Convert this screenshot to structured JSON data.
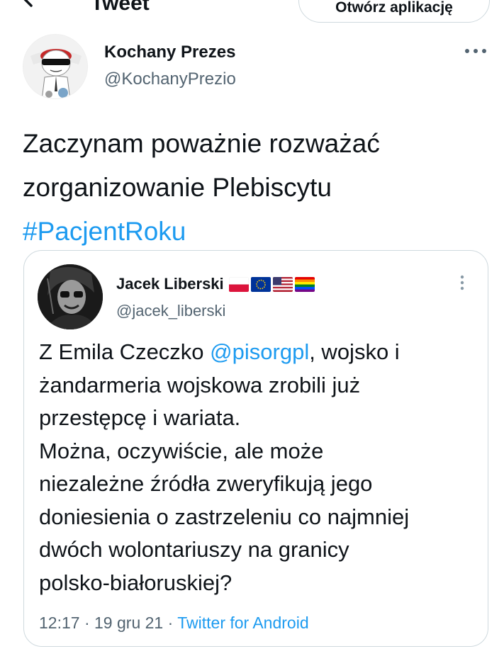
{
  "topbar": {
    "title": "Tweet",
    "open_app_label": "Otwórz aplikację"
  },
  "tweet": {
    "author_name": "Kochany Prezes",
    "author_handle": "@KochanyPrezio",
    "text_lines": [
      "Zaczynam poważnie rozważać",
      "zorganizowanie Plebiscytu"
    ],
    "hashtag": "#PacjentRoku"
  },
  "quoted_tweet": {
    "author_name": "Jacek Liberski",
    "author_handle": "@jacek_liberski",
    "flags": [
      "poland-flag",
      "eu-flag",
      "usa-flag",
      "rainbow-flag"
    ],
    "line1_prefix": "Z Emila Czeczko ",
    "mention": "@pisorgpl",
    "line1_suffix": ", wojsko i",
    "lines": [
      "żandarmeria wojskowa zrobili już",
      "przestępcę i wariata.",
      "Można, oczywiście, ale może",
      "niezależne źródła zweryfikują jego",
      "doniesienia o zastrzeleniu co najmniej",
      "dwóch wolontariuszy na granicy",
      "polsko-białoruskiej?"
    ],
    "time": "12:17",
    "date": "19 gru 21",
    "separator": " · ",
    "source": "Twitter for Android"
  },
  "colors": {
    "accent": "#1d9bf0",
    "text": "#0f1419",
    "muted": "#536471",
    "border": "#cfd9de"
  }
}
